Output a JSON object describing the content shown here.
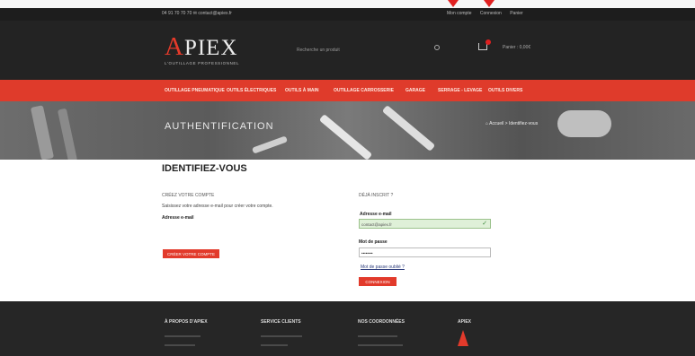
{
  "topbar": {
    "contact": "04 91 70 70 70  ✉ contact@apiex.fr",
    "links": [
      "Mon compte",
      "Connexion",
      "Panier"
    ]
  },
  "header": {
    "logo_text_first": "A",
    "logo_text_rest": "PIEX",
    "logo_tagline": "L'OUTILLAGE PROFESSIONNEL",
    "search_placeholder": "Recherche un produit",
    "cart_text": "Panier : 0,00€"
  },
  "nav": {
    "items": [
      "OUTILLAGE PNEUMATIQUE",
      "OUTILS ÉLECTRIQUES",
      "OUTILS À MAIN",
      "OUTILLAGE CARROSSERIE",
      "GARAGE",
      "SERRAGE - LEVAGE",
      "OUTILS DIVERS"
    ]
  },
  "banner": {
    "title": "AUTHENTIFICATION",
    "breadcrumb": "⌂ Accueil > Identifiez-vous"
  },
  "main": {
    "title": "IDENTIFIEZ-VOUS",
    "create": {
      "heading": "CRÉEZ VOTRE COMPTE",
      "text": "Saisissez votre adresse e-mail pour créer votre compte.",
      "email_label": "Adresse e-mail",
      "button": "CRÉER VOTRE COMPTE"
    },
    "login": {
      "heading": "DÉJÀ INSCRIT ?",
      "email_label": "Adresse e-mail",
      "email_value": "contact@apiex.fr",
      "password_label": "Mot de passe",
      "password_value": "••••••••",
      "forgot": "Mot de passe oublié ?",
      "button": "CONNEXION"
    }
  },
  "footer": {
    "columns": [
      "À PROPOS D'APIEX",
      "SERVICE CLIENTS",
      "NOS COORDONNÉES",
      "APIEX"
    ]
  },
  "colors": {
    "accent": "#df3b2b",
    "dark": "#232323",
    "valid": "#dff0d8"
  }
}
